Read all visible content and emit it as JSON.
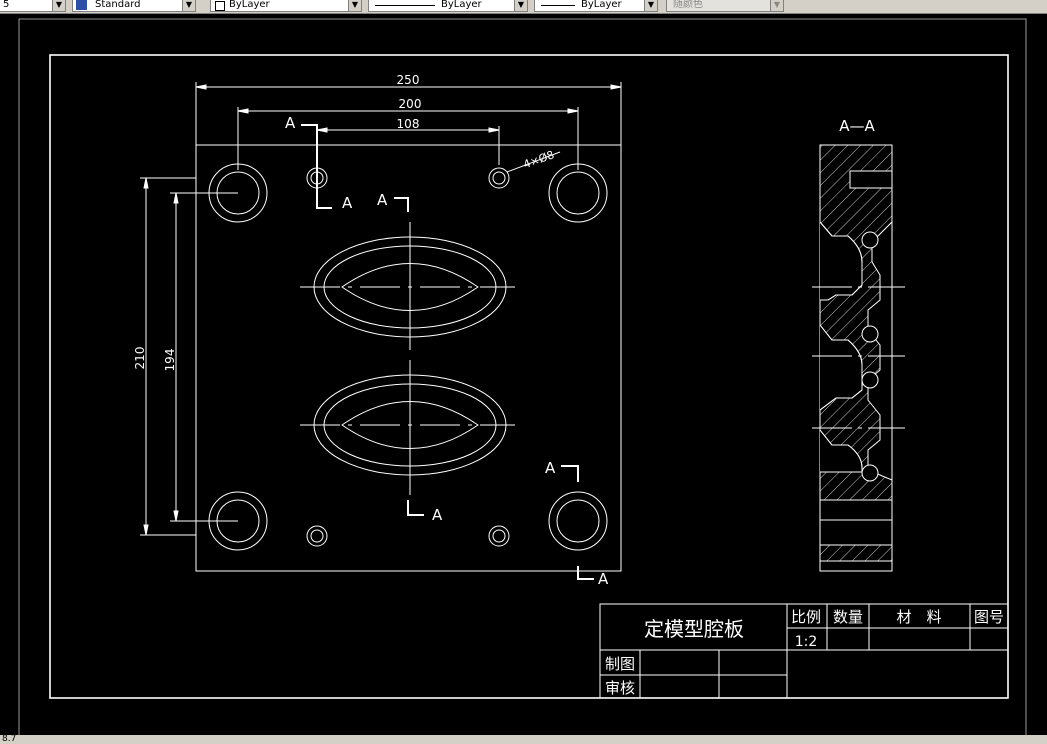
{
  "toolbar": {
    "first_value": "5",
    "text_style": "Standard",
    "layer": "ByLayer",
    "linetype": "ByLayer",
    "lineweight": "ByLayer",
    "color": "随颜色"
  },
  "drawing": {
    "overall_width": "250",
    "hole_spacing_x": "200",
    "pin_spacing_x": "108",
    "overall_height": "210",
    "hole_spacing_y": "194",
    "hole_note": "4×Ø8",
    "section_mark": "A",
    "section_title": "A—A"
  },
  "title_block": {
    "title": "定模型腔板",
    "ratio_label": "比例",
    "ratio_value": "1:2",
    "quantity_label": "数量",
    "material_label": "材　料",
    "drawing_no_label": "图号",
    "drafted_label": "制图",
    "checked_label": "审核"
  },
  "status": {
    "text": "8.7"
  }
}
